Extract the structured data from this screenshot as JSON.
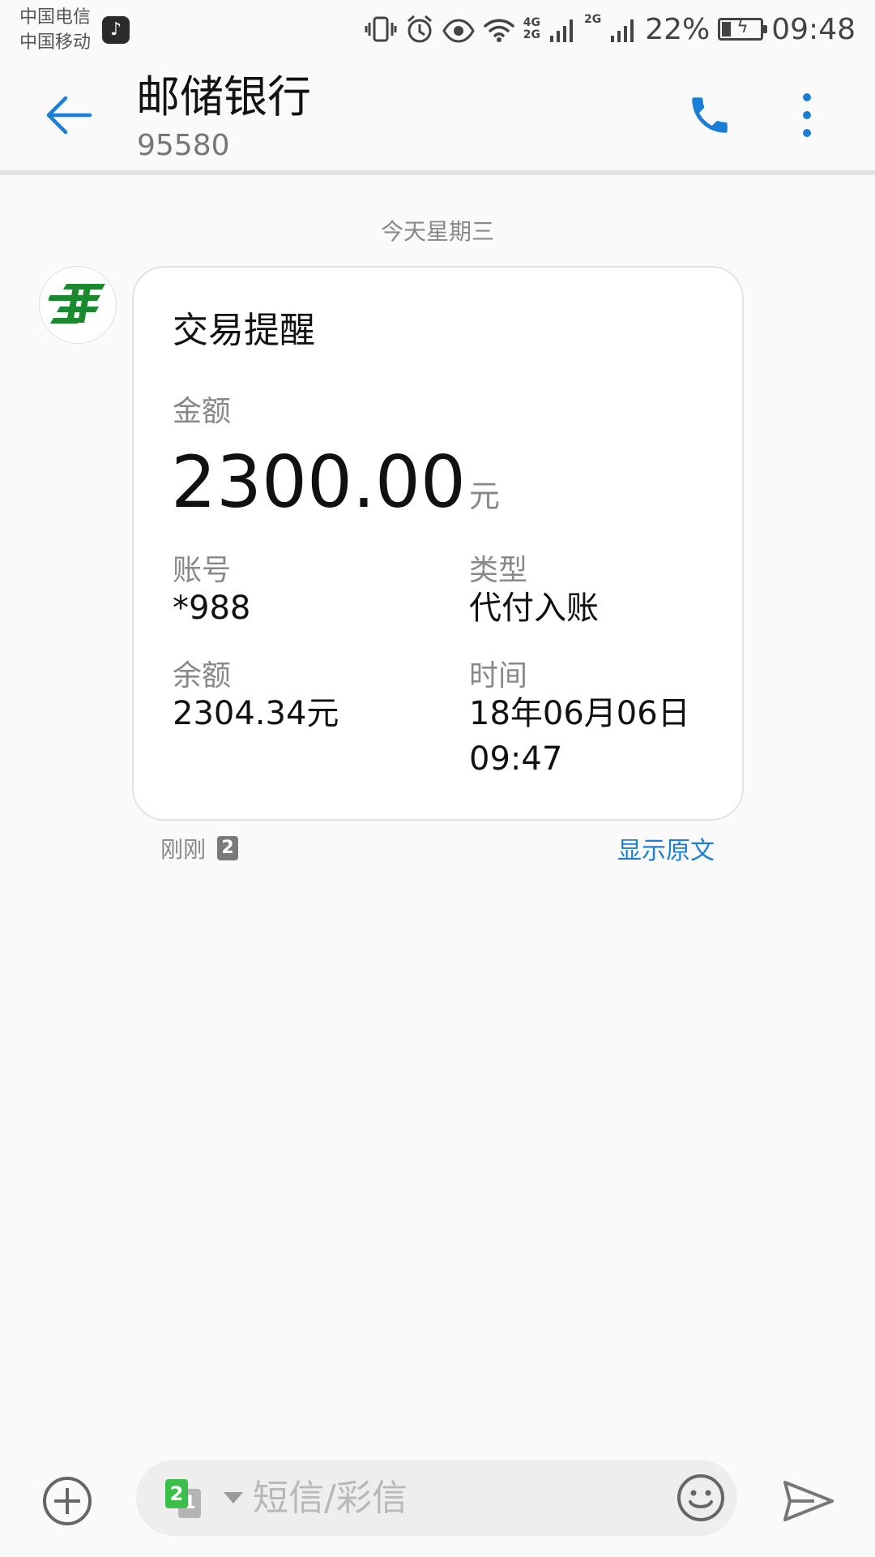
{
  "status_bar": {
    "carrier_1": "中国电信",
    "carrier_2": "中国移动",
    "network_1": "4G",
    "network_2": "2G",
    "network_3": "2G",
    "battery_percent": "22%",
    "time": "09:48",
    "battery_level": 0.22
  },
  "header": {
    "title": "邮储银行",
    "subtitle": "95580"
  },
  "conversation": {
    "date_separator": "今天星期三",
    "message": {
      "card_title": "交易提醒",
      "amount_label": "金额",
      "amount_value": "2300.00",
      "amount_unit": "元",
      "account_label": "账号",
      "account_value": "*988",
      "type_label": "类型",
      "type_value": "代付入账",
      "balance_label": "余额",
      "balance_value": "2304.34元",
      "time_label": "时间",
      "time_value_line1": "18年06月06日",
      "time_value_line2": "09:47",
      "timestamp": "刚刚",
      "sim_badge": "2",
      "show_original": "显示原文"
    }
  },
  "composer": {
    "sim_primary": "2",
    "sim_secondary": "1",
    "placeholder": "短信/彩信"
  },
  "colors": {
    "accent": "#1a7ed6",
    "bank_logo_green": "#1b8a2e",
    "sim2_green": "#3bbf4a"
  },
  "icons": {
    "back": "arrow-left-icon",
    "call": "phone-icon",
    "more": "more-vertical-icon",
    "add": "plus-circle-icon",
    "emoji": "smiley-icon",
    "send": "send-icon"
  }
}
